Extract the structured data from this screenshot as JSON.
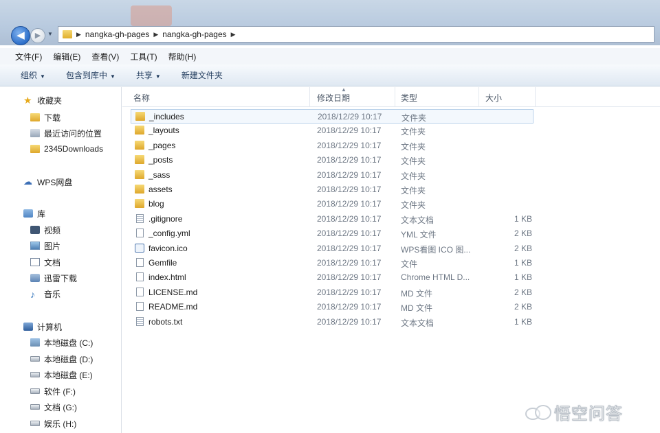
{
  "address": {
    "crumbs": [
      "nangka-gh-pages",
      "nangka-gh-pages"
    ]
  },
  "menu": [
    "文件(F)",
    "编辑(E)",
    "查看(V)",
    "工具(T)",
    "帮助(H)"
  ],
  "commands": [
    {
      "label": "组织",
      "has_dropdown": true
    },
    {
      "label": "包含到库中",
      "has_dropdown": true
    },
    {
      "label": "共享",
      "has_dropdown": true
    },
    {
      "label": "新建文件夹",
      "has_dropdown": false
    }
  ],
  "nav": {
    "favorites": {
      "label": "收藏夹",
      "icon": "star-icon",
      "items": [
        {
          "label": "下载",
          "icon": "download-folder-icon"
        },
        {
          "label": "最近访问的位置",
          "icon": "recent-places-icon"
        },
        {
          "label": "2345Downloads",
          "icon": "folder-icon"
        }
      ]
    },
    "wps": {
      "label": "WPS网盘",
      "icon": "cloud-icon"
    },
    "libraries": {
      "label": "库",
      "icon": "library-icon",
      "items": [
        {
          "label": "视频",
          "icon": "video-icon"
        },
        {
          "label": "图片",
          "icon": "picture-icon"
        },
        {
          "label": "文档",
          "icon": "document-icon"
        },
        {
          "label": "迅雷下载",
          "icon": "download-icon"
        },
        {
          "label": "音乐",
          "icon": "music-icon"
        }
      ]
    },
    "computer": {
      "label": "计算机",
      "icon": "computer-icon",
      "items": [
        {
          "label": "本地磁盘 (C:)",
          "icon": "system-drive-icon"
        },
        {
          "label": "本地磁盘 (D:)",
          "icon": "drive-icon"
        },
        {
          "label": "本地磁盘 (E:)",
          "icon": "drive-icon"
        },
        {
          "label": "软件 (F:)",
          "icon": "drive-icon"
        },
        {
          "label": "文档 (G:)",
          "icon": "drive-icon"
        },
        {
          "label": "娱乐 (H:)",
          "icon": "drive-icon"
        }
      ]
    }
  },
  "columns": {
    "name": "名称",
    "date": "修改日期",
    "type": "类型",
    "size": "大小"
  },
  "files": [
    {
      "name": "_includes",
      "date": "2018/12/29 10:17",
      "type": "文件夹",
      "size": "",
      "icon": "folder-icon",
      "selected": true
    },
    {
      "name": "_layouts",
      "date": "2018/12/29 10:17",
      "type": "文件夹",
      "size": "",
      "icon": "folder-icon"
    },
    {
      "name": "_pages",
      "date": "2018/12/29 10:17",
      "type": "文件夹",
      "size": "",
      "icon": "folder-icon"
    },
    {
      "name": "_posts",
      "date": "2018/12/29 10:17",
      "type": "文件夹",
      "size": "",
      "icon": "folder-icon"
    },
    {
      "name": "_sass",
      "date": "2018/12/29 10:17",
      "type": "文件夹",
      "size": "",
      "icon": "folder-icon"
    },
    {
      "name": "assets",
      "date": "2018/12/29 10:17",
      "type": "文件夹",
      "size": "",
      "icon": "folder-icon"
    },
    {
      "name": "blog",
      "date": "2018/12/29 10:17",
      "type": "文件夹",
      "size": "",
      "icon": "folder-icon"
    },
    {
      "name": ".gitignore",
      "date": "2018/12/29 10:17",
      "type": "文本文档",
      "size": "1 KB",
      "icon": "text-file-icon"
    },
    {
      "name": "_config.yml",
      "date": "2018/12/29 10:17",
      "type": "YML 文件",
      "size": "2 KB",
      "icon": "file-icon"
    },
    {
      "name": "favicon.ico",
      "date": "2018/12/29 10:17",
      "type": "WPS看图 ICO 图...",
      "size": "2 KB",
      "icon": "image-file-icon"
    },
    {
      "name": "Gemfile",
      "date": "2018/12/29 10:17",
      "type": "文件",
      "size": "1 KB",
      "icon": "file-icon"
    },
    {
      "name": "index.html",
      "date": "2018/12/29 10:17",
      "type": "Chrome HTML D...",
      "size": "1 KB",
      "icon": "file-icon"
    },
    {
      "name": "LICENSE.md",
      "date": "2018/12/29 10:17",
      "type": "MD 文件",
      "size": "2 KB",
      "icon": "file-icon"
    },
    {
      "name": "README.md",
      "date": "2018/12/29 10:17",
      "type": "MD 文件",
      "size": "2 KB",
      "icon": "file-icon"
    },
    {
      "name": "robots.txt",
      "date": "2018/12/29 10:17",
      "type": "文本文档",
      "size": "1 KB",
      "icon": "text-file-icon"
    }
  ],
  "watermark": {
    "text": "悟空问答"
  }
}
